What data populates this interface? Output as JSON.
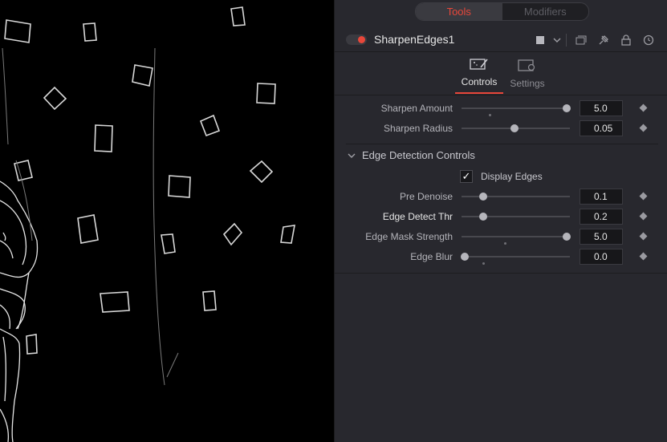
{
  "tabs": {
    "tools": "Tools",
    "modifiers": "Modifiers"
  },
  "node": {
    "name": "SharpenEdges1",
    "enabled": true
  },
  "header_icons": [
    "color-swatch-icon",
    "chevron-down-icon",
    "versions-icon",
    "pin-icon",
    "lock-icon",
    "reset-icon"
  ],
  "control_tabs": {
    "controls": "Controls",
    "settings": "Settings"
  },
  "params_top": [
    {
      "label": "Sharpen Amount",
      "value": "5.0",
      "fraction": 0.97,
      "default_fraction": 0.26
    },
    {
      "label": "Sharpen Radius",
      "value": "0.05",
      "fraction": 0.49,
      "default_fraction": null
    }
  ],
  "group": {
    "title": "Edge Detection Controls",
    "expanded": true
  },
  "display_edges": {
    "label": "Display Edges",
    "checked": true,
    "mark": "✓"
  },
  "params_group": [
    {
      "label": "Pre Denoise",
      "value": "0.1",
      "fraction": 0.2,
      "default_fraction": null
    },
    {
      "label": "Edge Detect Thr",
      "value": "0.2",
      "fraction": 0.2,
      "default_fraction": null
    },
    {
      "label": "Edge Mask Strength",
      "value": "5.0",
      "fraction": 0.97,
      "default_fraction": 0.4
    },
    {
      "label": "Edge Blur",
      "value": "0.0",
      "fraction": 0.03,
      "default_fraction": 0.2
    }
  ],
  "colors": {
    "accent": "#e8473a",
    "panel": "#28282e",
    "viewer": "#000000"
  }
}
